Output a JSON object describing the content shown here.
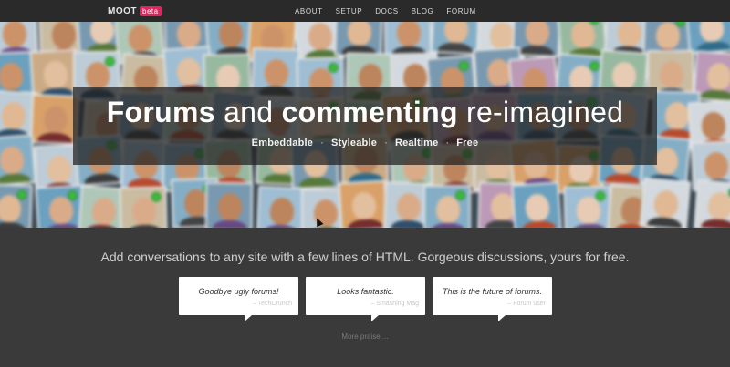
{
  "brand": {
    "name": "MOOT",
    "badge": "beta",
    "badge_color": "#e0245e"
  },
  "nav": {
    "items": [
      "ABOUT",
      "SETUP",
      "DOCS",
      "BLOG",
      "FORUM"
    ]
  },
  "hero": {
    "title_bold_1": "Forums",
    "title_light_1": "and",
    "title_bold_2": "commenting",
    "title_light_2": "re-imagined",
    "features": [
      "Embeddable",
      "Styleable",
      "Realtime",
      "Free"
    ],
    "separator": "·"
  },
  "tagline": "Add conversations to any site with a few lines of HTML. Gorgeous discussions, yours for free.",
  "quotes": [
    {
      "text": "Goodbye ugly forums!",
      "source": "– TechCrunch"
    },
    {
      "text": "Looks fantastic.",
      "source": "– Smashing Mag"
    },
    {
      "text": "This is the future of forums.",
      "source": "– Forum user"
    }
  ],
  "more_praise": "More praise ...",
  "colors": {
    "online_dot": "#3cc43c",
    "background": "#3a3a3a"
  }
}
